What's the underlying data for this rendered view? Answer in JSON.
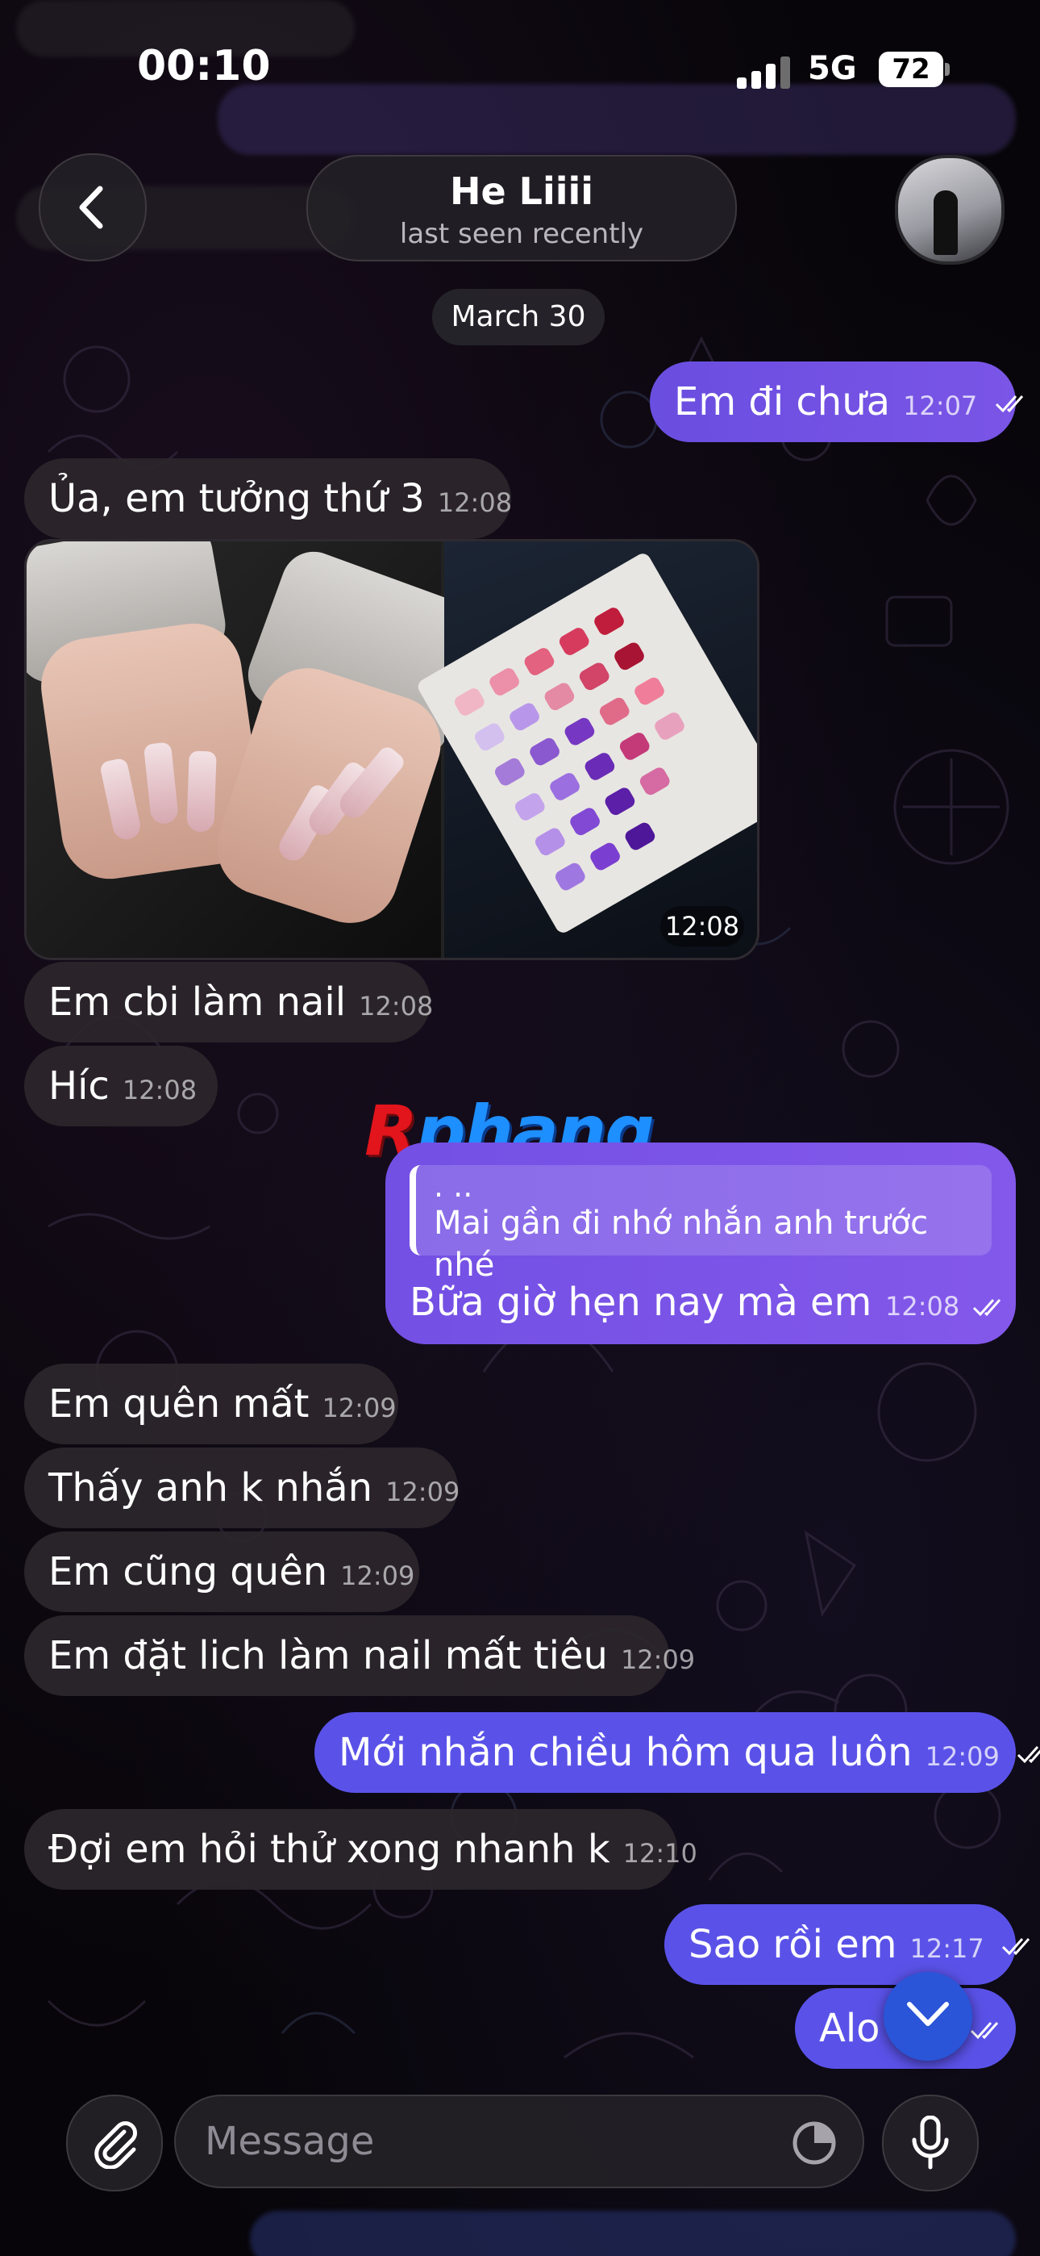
{
  "status_bar": {
    "time": "00:10",
    "network": "5G",
    "battery": "72"
  },
  "header": {
    "contact_name": "He Liiii",
    "contact_status": "last seen recently"
  },
  "date_separator": "March 30",
  "messages": [
    {
      "dir": "out",
      "text": "Em đi chưa",
      "time": "12:07"
    },
    {
      "dir": "in",
      "text": "Ủa, em tưởng thứ 3",
      "time": "12:08"
    },
    {
      "dir": "in",
      "type": "album",
      "time": "12:08"
    },
    {
      "dir": "in",
      "text": "Em cbi làm nail",
      "time": "12:08"
    },
    {
      "dir": "in",
      "text": "Híc",
      "time": "12:08"
    },
    {
      "dir": "out",
      "type": "reply",
      "reply_author": ". ..",
      "reply_text": "Mai gần đi nhớ nhắn anh trước nhé",
      "text": "Bữa giờ hẹn nay mà em",
      "time": "12:08"
    },
    {
      "dir": "in",
      "text": "Em quên mất",
      "time": "12:09"
    },
    {
      "dir": "in",
      "text": "Thấy anh k nhắn",
      "time": "12:09"
    },
    {
      "dir": "in",
      "text": "Em cũng quên",
      "time": "12:09"
    },
    {
      "dir": "in",
      "text": "Em đặt lich làm nail mất tiêu",
      "time": "12:09"
    },
    {
      "dir": "out",
      "text": "Mới nhắn chiều hôm qua luôn",
      "time": "12:09"
    },
    {
      "dir": "in",
      "text": "Đợi em hỏi thử xong nhanh k",
      "time": "12:10"
    },
    {
      "dir": "out",
      "text": "Sao rồi em",
      "time": "12:17"
    },
    {
      "dir": "out",
      "text": "Alo",
      "time": ""
    }
  ],
  "watermark": {
    "first": "R",
    "rest": "phang"
  },
  "composer": {
    "placeholder": "Message"
  },
  "colors": {
    "outgoing": "#7652e6",
    "incoming": "#2c262c",
    "accent_blue": "#2a55d8",
    "watermark_blue": "#1e8fff",
    "watermark_red": "#e2141c"
  },
  "icons": [
    "back-chevron-icon",
    "attach-paperclip-icon",
    "sticker-clock-icon",
    "microphone-icon",
    "chevron-down-icon",
    "double-check-icon"
  ]
}
